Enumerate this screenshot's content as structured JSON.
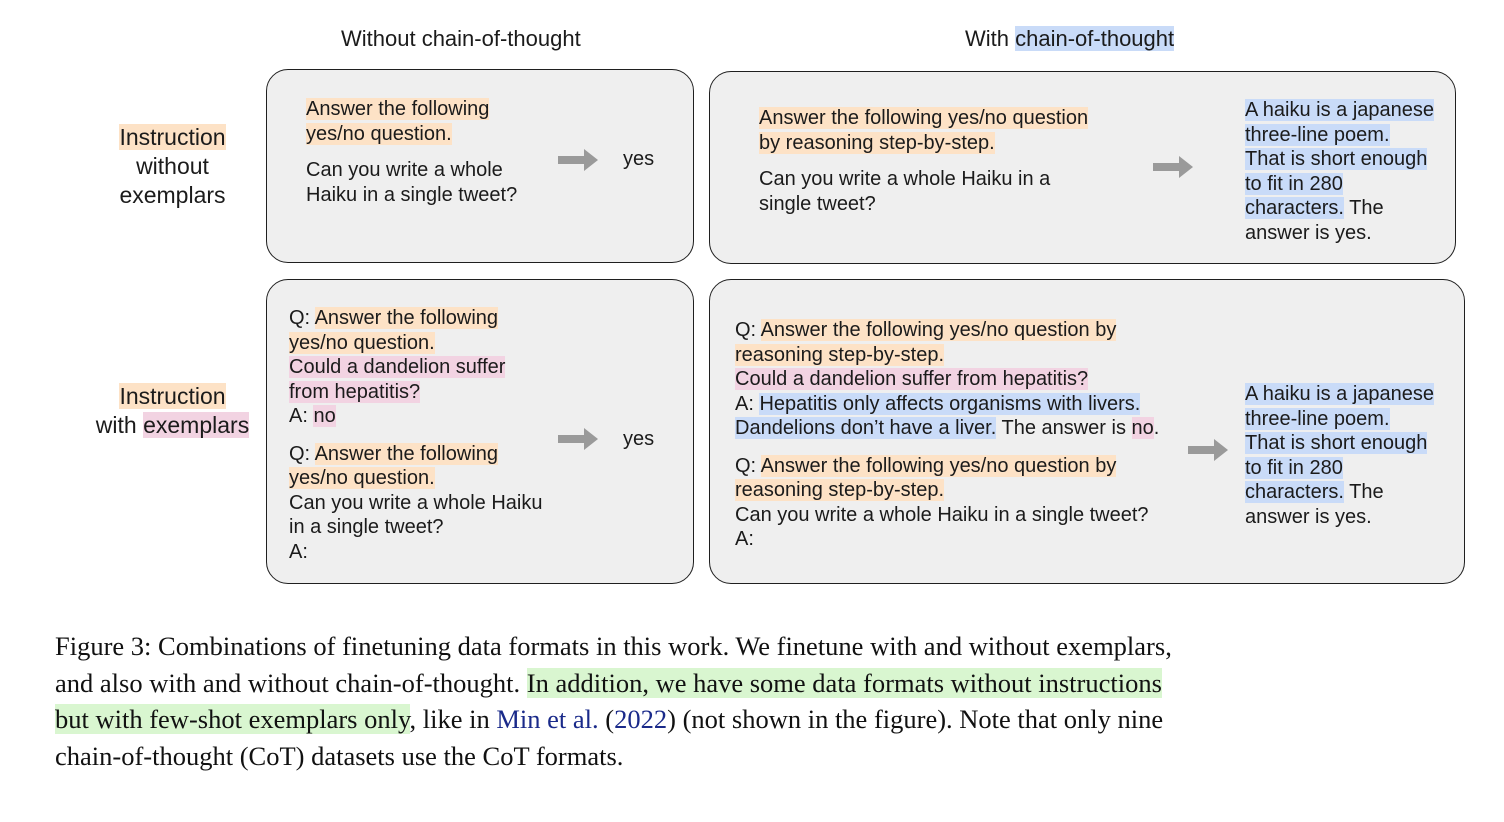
{
  "headers": {
    "left": "Without chain-of-thought",
    "right_plain": "With",
    "right_highlight": "chain-of-thought"
  },
  "row_labels": {
    "top": {
      "l1": "Instruction",
      "l2": "without",
      "l3": "exemplars"
    },
    "bottom": {
      "l1": "Instruction",
      "l2_plain": "with",
      "l2_highlight": "exemplars"
    }
  },
  "cells": {
    "top_left": {
      "lines": [
        "Answer the following",
        "yes/no question.",
        "Can you write a whole",
        "Haiku in a single tweet?"
      ],
      "answer": "yes"
    },
    "top_right": {
      "lines": [
        "Answer the following yes/no question",
        "by reasoning step-by-step.",
        "Can you write a whole Haiku in a",
        "single tweet?"
      ],
      "answer_lines": [
        "A haiku is a japanese",
        "three-line poem.",
        "That is short enough",
        "to fit in 280",
        "characters.",
        " The",
        "answer is yes."
      ]
    },
    "bottom_left": {
      "q_prefix": "Q: ",
      "a_prefix": "A: ",
      "a_bare": "A:",
      "lines": [
        "Answer the following",
        "yes/no question.",
        "Could a dandelion suffer",
        "from hepatitis?",
        "no",
        "Answer the following",
        "yes/no question.",
        "Can you write a whole Haiku",
        "in a single tweet?"
      ],
      "answer": "yes"
    },
    "bottom_right": {
      "q_prefix": "Q: ",
      "a_prefix": "A: ",
      "a_bare": "A:",
      "lines": [
        "Answer the following yes/no question by",
        "reasoning step-by-step.",
        "Could a dandelion suffer from hepatitis?",
        "Hepatitis only affects organisms with livers.",
        "Dandelions don’t have a liver.",
        " The answer is ",
        "no",
        ".",
        "Answer the following yes/no question by",
        "reasoning step-by-step.",
        "Can you write a whole Haiku in a single tweet?"
      ],
      "answer_lines": [
        "A haiku is a japanese",
        "three-line poem.",
        "That is short enough",
        "to fit in 280",
        "characters.",
        " The",
        "answer is yes."
      ]
    }
  },
  "caption": {
    "l1": "Figure 3: Combinations of finetuning data formats in this work. We finetune with and without exemplars,",
    "l2_plain": "and also with and without chain-of-thought. ",
    "l2_highlight": "In addition, we have some data formats without instructions",
    "l3_highlight": "but with few-shot exemplars only",
    "l3_a": ", like in ",
    "l3_link": "Min et al.",
    "l3_b": " (",
    "l3_year": "2022",
    "l3_c": ") (not shown in the figure). Note that only nine",
    "l4": "chain-of-thought (CoT) datasets use the CoT formats."
  },
  "colors": {
    "instruction": "#fde2c6",
    "exemplar": "#f2d3e2",
    "cot": "#c9dbf8",
    "caption_highlight": "#d9f6d0",
    "box_fill": "#efefef",
    "arrow": "#9a9a9a",
    "link": "#1a2a8a"
  },
  "icons": [
    "right-arrow-icon"
  ]
}
